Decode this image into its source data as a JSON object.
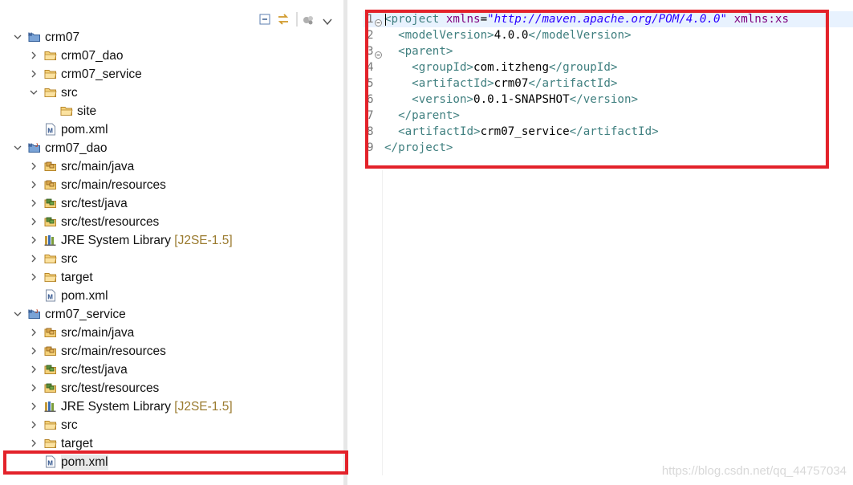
{
  "explorer": {
    "toolbar": [
      "collapse-all-icon",
      "link-with-editor-icon",
      "filters-icon",
      "view-menu-icon"
    ],
    "tree": [
      {
        "indent": 0,
        "expanded": true,
        "icon": "maven-project-icon",
        "label": "crm07"
      },
      {
        "indent": 1,
        "expanded": false,
        "icon": "folder-icon",
        "label": "crm07_dao"
      },
      {
        "indent": 1,
        "expanded": false,
        "icon": "folder-icon",
        "label": "crm07_service"
      },
      {
        "indent": 1,
        "expanded": true,
        "icon": "folder-icon",
        "label": "src"
      },
      {
        "indent": 2,
        "expanded": null,
        "icon": "folder-icon",
        "label": "site"
      },
      {
        "indent": 1,
        "expanded": null,
        "icon": "maven-pom-icon",
        "label": "pom.xml"
      },
      {
        "indent": 0,
        "expanded": true,
        "icon": "maven-java-project-icon",
        "label": "crm07_dao"
      },
      {
        "indent": 1,
        "expanded": false,
        "icon": "source-folder-icon",
        "label": "src/main/java"
      },
      {
        "indent": 1,
        "expanded": false,
        "icon": "source-folder-icon",
        "label": "src/main/resources"
      },
      {
        "indent": 1,
        "expanded": false,
        "icon": "test-folder-icon",
        "label": "src/test/java"
      },
      {
        "indent": 1,
        "expanded": false,
        "icon": "test-folder-icon",
        "label": "src/test/resources"
      },
      {
        "indent": 1,
        "expanded": false,
        "icon": "library-icon",
        "label": "JRE System Library",
        "decoration": "[J2SE-1.5]"
      },
      {
        "indent": 1,
        "expanded": false,
        "icon": "folder-icon",
        "label": "src"
      },
      {
        "indent": 1,
        "expanded": false,
        "icon": "folder-icon",
        "label": "target"
      },
      {
        "indent": 1,
        "expanded": null,
        "icon": "maven-pom-icon",
        "label": "pom.xml"
      },
      {
        "indent": 0,
        "expanded": true,
        "icon": "maven-java-project-icon",
        "label": "crm07_service"
      },
      {
        "indent": 1,
        "expanded": false,
        "icon": "source-folder-icon",
        "label": "src/main/java"
      },
      {
        "indent": 1,
        "expanded": false,
        "icon": "source-folder-icon",
        "label": "src/main/resources"
      },
      {
        "indent": 1,
        "expanded": false,
        "icon": "test-folder-icon",
        "label": "src/test/java"
      },
      {
        "indent": 1,
        "expanded": false,
        "icon": "test-folder-icon",
        "label": "src/test/resources"
      },
      {
        "indent": 1,
        "expanded": false,
        "icon": "library-icon",
        "label": "JRE System Library",
        "decoration": "[J2SE-1.5]"
      },
      {
        "indent": 1,
        "expanded": false,
        "icon": "folder-icon",
        "label": "src"
      },
      {
        "indent": 1,
        "expanded": false,
        "icon": "folder-icon",
        "label": "target"
      },
      {
        "indent": 1,
        "expanded": null,
        "icon": "maven-pom-icon",
        "label": "pom.xml",
        "selected": true
      }
    ]
  },
  "editor": {
    "current_line": 1,
    "lines": [
      {
        "n": "1",
        "fold": true,
        "tokens": [
          [
            "tag",
            "<project "
          ],
          [
            "attr",
            "xmlns"
          ],
          [
            "txt",
            "="
          ],
          [
            "val",
            "\"http://maven.apache.org/POM/4.0.0\""
          ],
          [
            "txt",
            " "
          ],
          [
            "attr",
            "xmlns:xs"
          ]
        ]
      },
      {
        "n": "2",
        "fold": false,
        "tokens": [
          [
            "txt",
            "  "
          ],
          [
            "tag",
            "<modelVersion>"
          ],
          [
            "txt",
            "4.0.0"
          ],
          [
            "tag",
            "</modelVersion>"
          ]
        ]
      },
      {
        "n": "3",
        "fold": true,
        "tokens": [
          [
            "txt",
            "  "
          ],
          [
            "tag",
            "<parent>"
          ]
        ]
      },
      {
        "n": "4",
        "fold": false,
        "tokens": [
          [
            "txt",
            "    "
          ],
          [
            "tag",
            "<groupId>"
          ],
          [
            "txt",
            "com.itzheng"
          ],
          [
            "tag",
            "</groupId>"
          ]
        ]
      },
      {
        "n": "5",
        "fold": false,
        "tokens": [
          [
            "txt",
            "    "
          ],
          [
            "tag",
            "<artifactId>"
          ],
          [
            "txt",
            "crm07"
          ],
          [
            "tag",
            "</artifactId>"
          ]
        ]
      },
      {
        "n": "6",
        "fold": false,
        "tokens": [
          [
            "txt",
            "    "
          ],
          [
            "tag",
            "<version>"
          ],
          [
            "txt",
            "0.0.1-SNAPSHOT"
          ],
          [
            "tag",
            "</version>"
          ]
        ]
      },
      {
        "n": "7",
        "fold": false,
        "tokens": [
          [
            "txt",
            "  "
          ],
          [
            "tag",
            "</parent>"
          ]
        ]
      },
      {
        "n": "8",
        "fold": false,
        "tokens": [
          [
            "txt",
            "  "
          ],
          [
            "tag",
            "<artifactId>"
          ],
          [
            "txt",
            "crm07_service"
          ],
          [
            "tag",
            "</artifactId>"
          ]
        ]
      },
      {
        "n": "9",
        "fold": false,
        "tokens": [
          [
            "tag",
            "</project>"
          ]
        ]
      }
    ]
  },
  "highlights": [
    "pom-editor-box",
    "service-pom-box"
  ],
  "watermark": "https://blog.csdn.net/qq_44757034",
  "colors": {
    "highlight": "#e3222a",
    "tag": "#3f7f7f",
    "attr": "#7f007f",
    "value": "#2a00ff",
    "decoration": "#9a7a2e",
    "folder": "#e8b548"
  }
}
